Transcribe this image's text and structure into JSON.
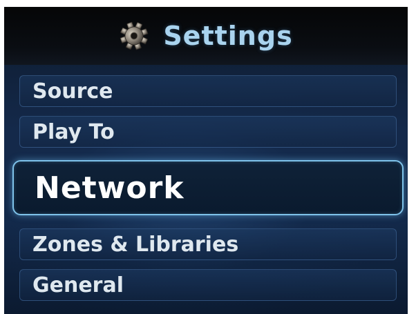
{
  "header": {
    "title": "Settings",
    "icon": "gear-icon"
  },
  "menu": {
    "items": [
      {
        "label": "Source",
        "selected": false
      },
      {
        "label": "Play To",
        "selected": false
      },
      {
        "label": "Network",
        "selected": true
      },
      {
        "label": "Zones & Libraries",
        "selected": false
      },
      {
        "label": "General",
        "selected": false
      }
    ]
  },
  "colors": {
    "title_text": "#a9d3ee",
    "selected_border": "#7fc3ea",
    "background": "#14294a"
  }
}
